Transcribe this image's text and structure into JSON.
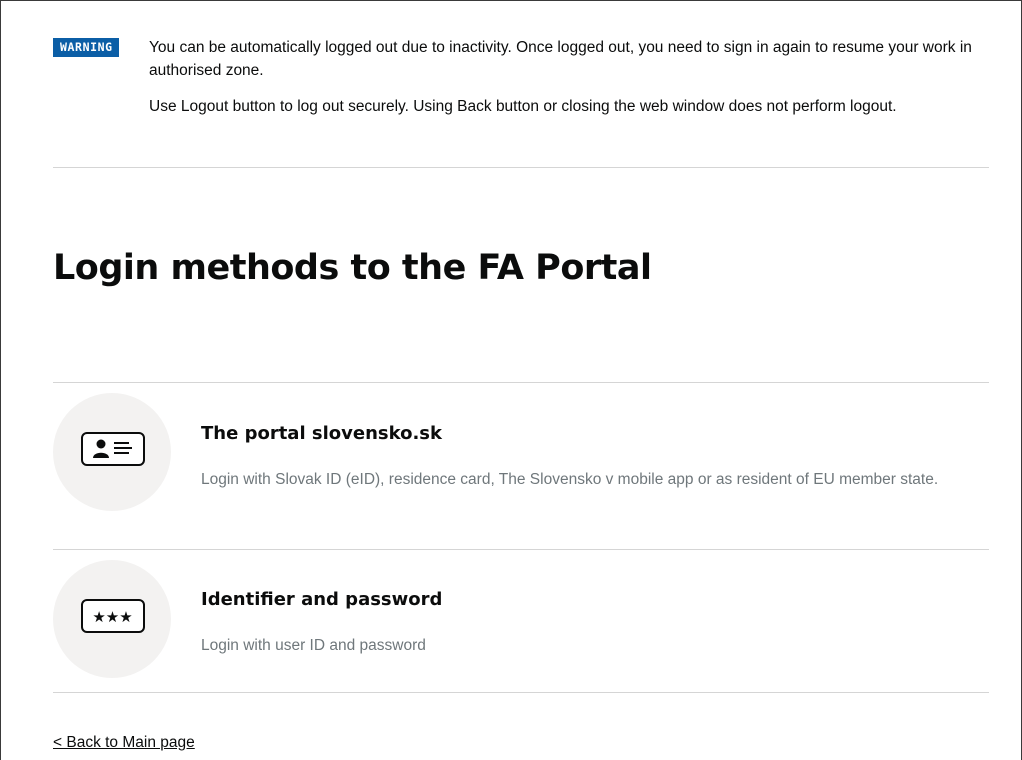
{
  "warning": {
    "badge": "WARNING",
    "paragraph1": "You can be automatically logged out due to inactivity. Once logged out, you need to sign in again to resume your work in authorised zone.",
    "paragraph2": "Use Logout button to log out securely. Using Back button or closing the web window does not perform logout."
  },
  "page_title": "Login methods to the FA Portal",
  "methods": [
    {
      "icon": "id-card-icon",
      "title": "The portal slovensko.sk",
      "description": "Login with Slovak ID (eID), residence card, The Slovensko v mobile app or as resident of EU member state."
    },
    {
      "icon": "password-icon",
      "title": "Identifier and password",
      "description": "Login with user ID and password"
    }
  ],
  "back_link": "< Back to Main page",
  "colors": {
    "badge_bg": "#0b5ea6",
    "text": "#0b0c0c",
    "muted_text": "#6f777b",
    "icon_circle": "#f3f2f1",
    "divider": "#d5d5d5"
  }
}
